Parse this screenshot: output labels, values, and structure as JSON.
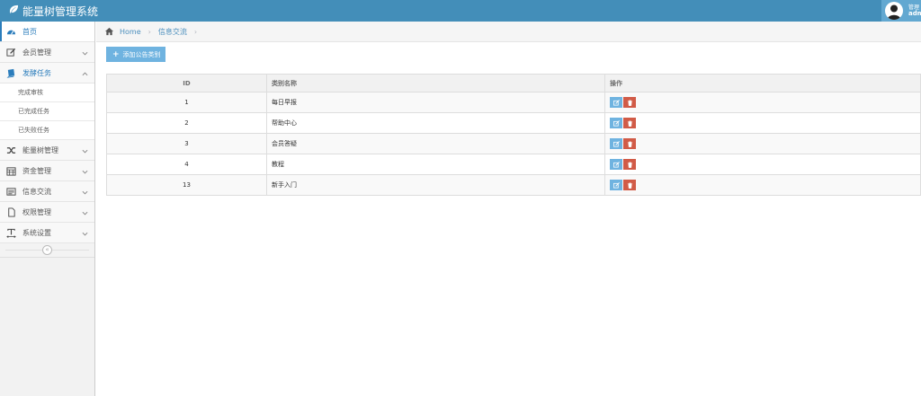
{
  "app": {
    "title": "能量树管理系统"
  },
  "user": {
    "line1": "管理",
    "line2": "admin"
  },
  "sidebar": {
    "items": [
      {
        "label": "首页",
        "icon": "dashboard-icon"
      },
      {
        "label": "会员管理",
        "icon": "edit-icon"
      },
      {
        "label": "发酵任务",
        "icon": "book-icon"
      },
      {
        "label": "能量树管理",
        "icon": "random-icon"
      },
      {
        "label": "资金管理",
        "icon": "calendar-icon"
      },
      {
        "label": "信息交流",
        "icon": "list-alt-icon"
      },
      {
        "label": "权限管理",
        "icon": "file-icon"
      },
      {
        "label": "系统设置",
        "icon": "text-width-icon"
      }
    ],
    "submenu": [
      "完成审核",
      "已完成任务",
      "已失败任务"
    ],
    "collapse": "«"
  },
  "breadcrumb": {
    "home": "Home",
    "current": "信息交流"
  },
  "toolbar": {
    "add_label": "添加公告类别"
  },
  "table": {
    "headers": [
      "ID",
      "类别名称",
      "操作"
    ],
    "rows": [
      {
        "id": "1",
        "name": "每日早报"
      },
      {
        "id": "2",
        "name": "帮助中心"
      },
      {
        "id": "3",
        "name": "会员答疑"
      },
      {
        "id": "4",
        "name": "教程"
      },
      {
        "id": "13",
        "name": "新手入门"
      }
    ]
  },
  "colors": {
    "navbar": "#438eb9",
    "accent": "#2b7dbc",
    "edit": "#6fb3e0",
    "delete": "#d15b47"
  }
}
